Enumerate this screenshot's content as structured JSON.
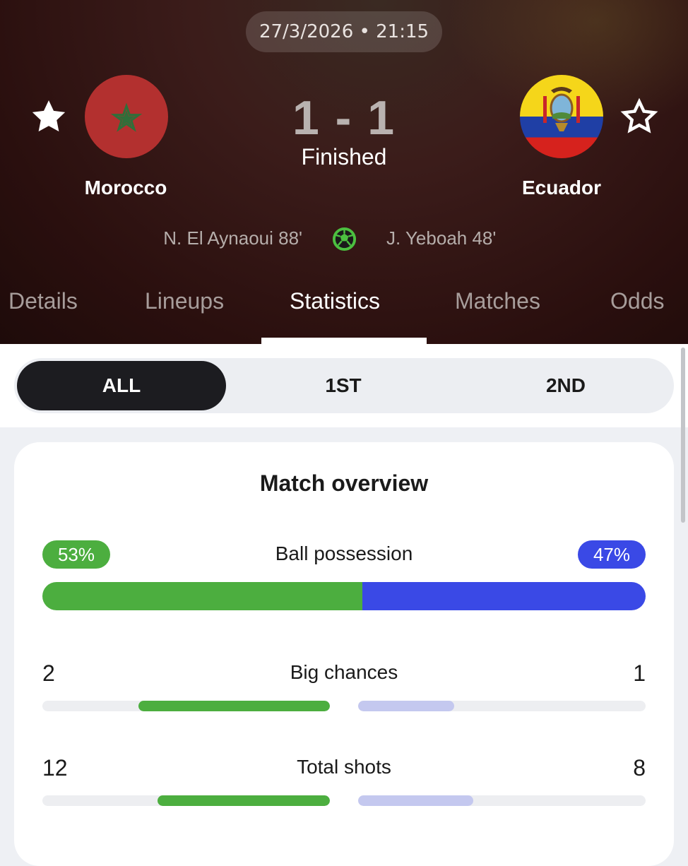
{
  "match": {
    "datetime": "27/3/2026 • 21:15",
    "home": {
      "name": "Morocco",
      "favorite": true,
      "flag_color": "#b3302f",
      "star_color": "#2f6f3a"
    },
    "away": {
      "name": "Ecuador",
      "favorite": false,
      "flag_colors": [
        "#f5d61a",
        "#1f3fa5",
        "#d6221d"
      ]
    },
    "score": "1 - 1",
    "status": "Finished",
    "scorers": {
      "home": "N. El Aynaoui 88'",
      "away": "J. Yeboah 48'"
    }
  },
  "tabs": [
    "Details",
    "Lineups",
    "Statistics",
    "Matches",
    "Odds"
  ],
  "active_tab": "Statistics",
  "periods": [
    "ALL",
    "1ST",
    "2ND"
  ],
  "active_period": "ALL",
  "overview": {
    "title": "Match overview",
    "possession": {
      "label": "Ball possession",
      "home": "53%",
      "away": "47%",
      "home_value": 53,
      "away_value": 47
    },
    "stats": [
      {
        "label": "Big chances",
        "home": "2",
        "away": "1",
        "home_fraction": 0.667,
        "away_fraction": 0.333
      },
      {
        "label": "Total shots",
        "home": "12",
        "away": "8",
        "home_fraction": 0.6,
        "away_fraction": 0.4
      }
    ]
  },
  "colors": {
    "home": "#4cae3f",
    "away": "#3a49e6",
    "away_light": "#c4c8ef"
  }
}
